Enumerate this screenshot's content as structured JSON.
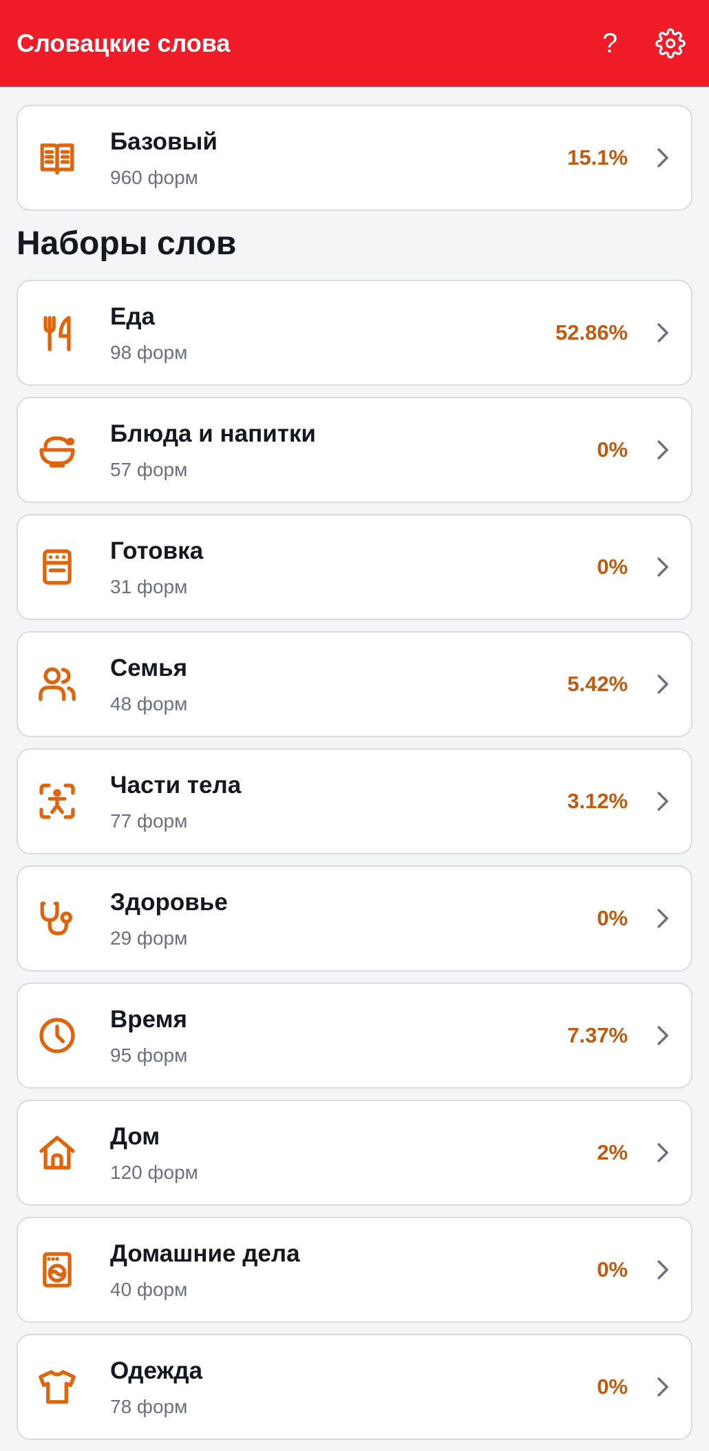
{
  "header": {
    "title": "Словацкие слова",
    "help_label": "?",
    "settings_icon": "gear-icon",
    "bg_color": "#ef1c27"
  },
  "accent_color": "#e0640c",
  "percent_color": "#bf5a10",
  "basic": {
    "title": "Базовый",
    "subtitle": "960 форм",
    "percent": "15.1%",
    "icon": "book-icon"
  },
  "section": {
    "title": "Наборы слов"
  },
  "sets": [
    {
      "title": "Еда",
      "subtitle": "98 форм",
      "percent": "52.86%",
      "icon": "fork-knife-icon"
    },
    {
      "title": "Блюда и напитки",
      "subtitle": "57 форм",
      "percent": "0%",
      "icon": "bowl-icon"
    },
    {
      "title": "Готовка",
      "subtitle": "31 форм",
      "percent": "0%",
      "icon": "stove-icon"
    },
    {
      "title": "Семья",
      "subtitle": "48 форм",
      "percent": "5.42%",
      "icon": "people-icon"
    },
    {
      "title": "Части тела",
      "subtitle": "77 форм",
      "percent": "3.12%",
      "icon": "body-scan-icon"
    },
    {
      "title": "Здоровье",
      "subtitle": "29 форм",
      "percent": "0%",
      "icon": "stethoscope-icon"
    },
    {
      "title": "Время",
      "subtitle": "95 форм",
      "percent": "7.37%",
      "icon": "clock-icon"
    },
    {
      "title": "Дом",
      "subtitle": "120 форм",
      "percent": "2%",
      "icon": "house-icon"
    },
    {
      "title": "Домашние дела",
      "subtitle": "40 форм",
      "percent": "0%",
      "icon": "washing-machine-icon"
    },
    {
      "title": "Одежда",
      "subtitle": "78 форм",
      "percent": "0%",
      "icon": "shirt-icon"
    }
  ]
}
